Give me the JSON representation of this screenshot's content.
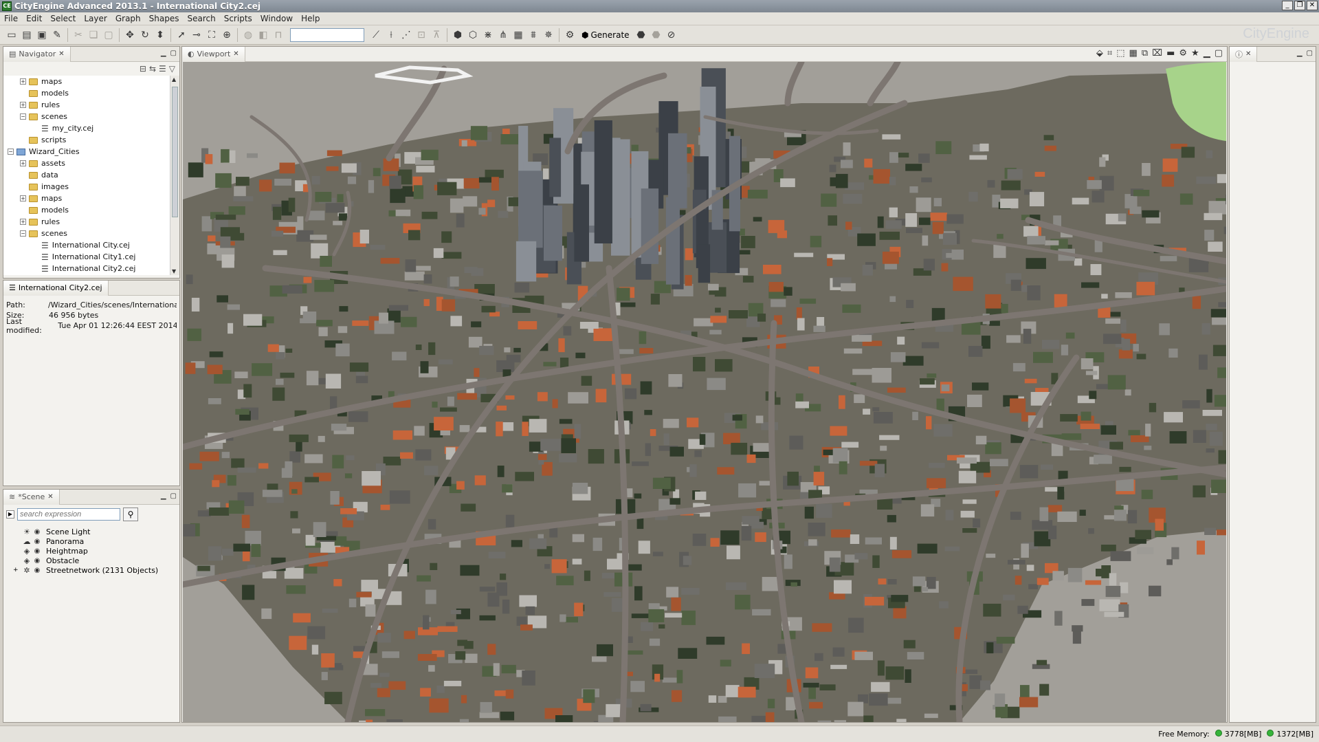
{
  "window": {
    "title": "CityEngine Advanced 2013.1 - International City2.cej",
    "app_icon_text": "CE",
    "controls": [
      "_",
      "❐",
      "✕"
    ]
  },
  "menu": [
    "File",
    "Edit",
    "Select",
    "Layer",
    "Graph",
    "Shapes",
    "Search",
    "Scripts",
    "Window",
    "Help"
  ],
  "toolbar": {
    "generate_label": "Generate",
    "brand": "CityEngine"
  },
  "navigator": {
    "tab_label": "Navigator",
    "items": [
      {
        "label": "maps",
        "depth": 1,
        "expander": "+",
        "kind": "folder"
      },
      {
        "label": "models",
        "depth": 1,
        "expander": "",
        "kind": "folder"
      },
      {
        "label": "rules",
        "depth": 1,
        "expander": "+",
        "kind": "folder"
      },
      {
        "label": "scenes",
        "depth": 1,
        "expander": "−",
        "kind": "folder"
      },
      {
        "label": "my_city.cej",
        "depth": 2,
        "expander": "",
        "kind": "cej"
      },
      {
        "label": "scripts",
        "depth": 1,
        "expander": "",
        "kind": "folder"
      },
      {
        "label": "Wizard_Cities",
        "depth": 0,
        "expander": "−",
        "kind": "project"
      },
      {
        "label": "assets",
        "depth": 1,
        "expander": "+",
        "kind": "folder"
      },
      {
        "label": "data",
        "depth": 1,
        "expander": "",
        "kind": "folder"
      },
      {
        "label": "images",
        "depth": 1,
        "expander": "",
        "kind": "folder"
      },
      {
        "label": "maps",
        "depth": 1,
        "expander": "+",
        "kind": "folder"
      },
      {
        "label": "models",
        "depth": 1,
        "expander": "",
        "kind": "folder"
      },
      {
        "label": "rules",
        "depth": 1,
        "expander": "+",
        "kind": "folder"
      },
      {
        "label": "scenes",
        "depth": 1,
        "expander": "−",
        "kind": "folder"
      },
      {
        "label": "International City.cej",
        "depth": 2,
        "expander": "",
        "kind": "cej"
      },
      {
        "label": "International City1.cej",
        "depth": 2,
        "expander": "",
        "kind": "cej"
      },
      {
        "label": "International City2.cej",
        "depth": 2,
        "expander": "",
        "kind": "cej"
      }
    ]
  },
  "file_info": {
    "tab_label": "International City2.cej",
    "path_label": "Path:",
    "path_value": "/Wizard_Cities/scenes/Internationa",
    "size_label": "Size:",
    "size_value": "46 956 bytes",
    "modified_label": "Last modified:",
    "modified_value": "Tue Apr 01 12:26:44 EEST 2014"
  },
  "scene": {
    "tab_label": "*Scene",
    "search_placeholder": "search expression",
    "items": [
      {
        "label": "Scene Light",
        "icon": "sun-icon",
        "glyph": "☀",
        "expander": ""
      },
      {
        "label": "Panorama",
        "icon": "cloud-icon",
        "glyph": "☁",
        "expander": ""
      },
      {
        "label": "Heightmap",
        "icon": "layer-icon",
        "glyph": "◈",
        "expander": ""
      },
      {
        "label": "Obstacle",
        "icon": "layer-icon",
        "glyph": "◈",
        "expander": ""
      },
      {
        "label": "Streetnetwork (2131 Objects)",
        "icon": "graph-icon",
        "glyph": "✲",
        "expander": "+"
      }
    ]
  },
  "viewport": {
    "tab_label": "Viewport"
  },
  "status": {
    "free_memory_label": "Free Memory:",
    "mem1": "3778[MB]",
    "mem2": "1372[MB]"
  },
  "colors": {
    "ground": "#9f9c96",
    "water": "#b7b4ae",
    "road": "#7a7470",
    "park": "#a7d38a"
  }
}
